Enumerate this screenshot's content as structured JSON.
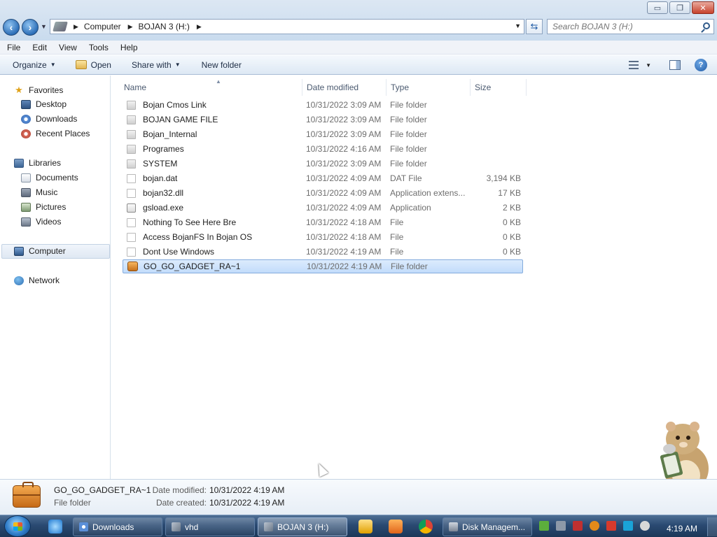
{
  "window": {
    "minimize_glyph": "▭",
    "maximize_glyph": "❐",
    "close_glyph": "✕"
  },
  "address_bar": {
    "crumbs": [
      "Computer",
      "BOJAN 3 (H:)"
    ],
    "search_placeholder": "Search BOJAN 3 (H:)"
  },
  "menu": [
    "File",
    "Edit",
    "View",
    "Tools",
    "Help"
  ],
  "commands": {
    "organize": "Organize",
    "open": "Open",
    "share_with": "Share with",
    "new_folder": "New folder"
  },
  "nav": {
    "favorites": {
      "label": "Favorites",
      "items": [
        "Desktop",
        "Downloads",
        "Recent Places"
      ]
    },
    "libraries": {
      "label": "Libraries",
      "items": [
        "Documents",
        "Music",
        "Pictures",
        "Videos"
      ]
    },
    "computer": "Computer",
    "network": "Network"
  },
  "columns": [
    "Name",
    "Date modified",
    "Type",
    "Size"
  ],
  "files": [
    {
      "name": "Bojan Cmos Link",
      "date": "10/31/2022 3:09 AM",
      "type": "File folder",
      "size": "",
      "icon": "folder-icon"
    },
    {
      "name": "BOJAN GAME FILE",
      "date": "10/31/2022 3:09 AM",
      "type": "File folder",
      "size": "",
      "icon": "folder-icon"
    },
    {
      "name": "Bojan_Internal",
      "date": "10/31/2022 3:09 AM",
      "type": "File folder",
      "size": "",
      "icon": "folder-icon"
    },
    {
      "name": "Programes",
      "date": "10/31/2022 4:16 AM",
      "type": "File folder",
      "size": "",
      "icon": "folder-icon"
    },
    {
      "name": "SYSTEM",
      "date": "10/31/2022 3:09 AM",
      "type": "File folder",
      "size": "",
      "icon": "folder-icon"
    },
    {
      "name": "bojan.dat",
      "date": "10/31/2022 4:09 AM",
      "type": "DAT File",
      "size": "3,194 KB",
      "icon": "file-icon"
    },
    {
      "name": "bojan32.dll",
      "date": "10/31/2022 4:09 AM",
      "type": "Application extens...",
      "size": "17 KB",
      "icon": "dll-icon"
    },
    {
      "name": "gsload.exe",
      "date": "10/31/2022 4:09 AM",
      "type": "Application",
      "size": "2 KB",
      "icon": "exe-icon"
    },
    {
      "name": "Nothing To See Here Bre",
      "date": "10/31/2022 4:18 AM",
      "type": "File",
      "size": "0 KB",
      "icon": "file-icon"
    },
    {
      "name": "Access BojanFS In Bojan OS",
      "date": "10/31/2022 4:18 AM",
      "type": "File",
      "size": "0 KB",
      "icon": "file-icon"
    },
    {
      "name": "Dont Use Windows",
      "date": "10/31/2022 4:19 AM",
      "type": "File",
      "size": "0 KB",
      "icon": "file-icon"
    },
    {
      "name": "GO_GO_GADGET_RA~1",
      "date": "10/31/2022 4:19 AM",
      "type": "File folder",
      "size": "",
      "icon": "gadget-folder-icon",
      "selected": true
    }
  ],
  "details": {
    "name": "GO_GO_GADGET_RA~1",
    "type": "File folder",
    "modified_label": "Date modified:",
    "modified_value": "10/31/2022 4:19 AM",
    "created_label": "Date created:",
    "created_value": "10/31/2022 4:19 AM"
  },
  "taskbar": {
    "buttons": [
      "Downloads",
      "vhd",
      "BOJAN 3 (H:)",
      "Disk Managem..."
    ],
    "active": "BOJAN 3 (H:)",
    "clock": "4:19 AM"
  },
  "colors": {
    "selection_fill": "#c9e0fb",
    "selection_border": "#84acdd",
    "taskbar": "#2a4a72",
    "meta_text": "#6d6d6d"
  }
}
